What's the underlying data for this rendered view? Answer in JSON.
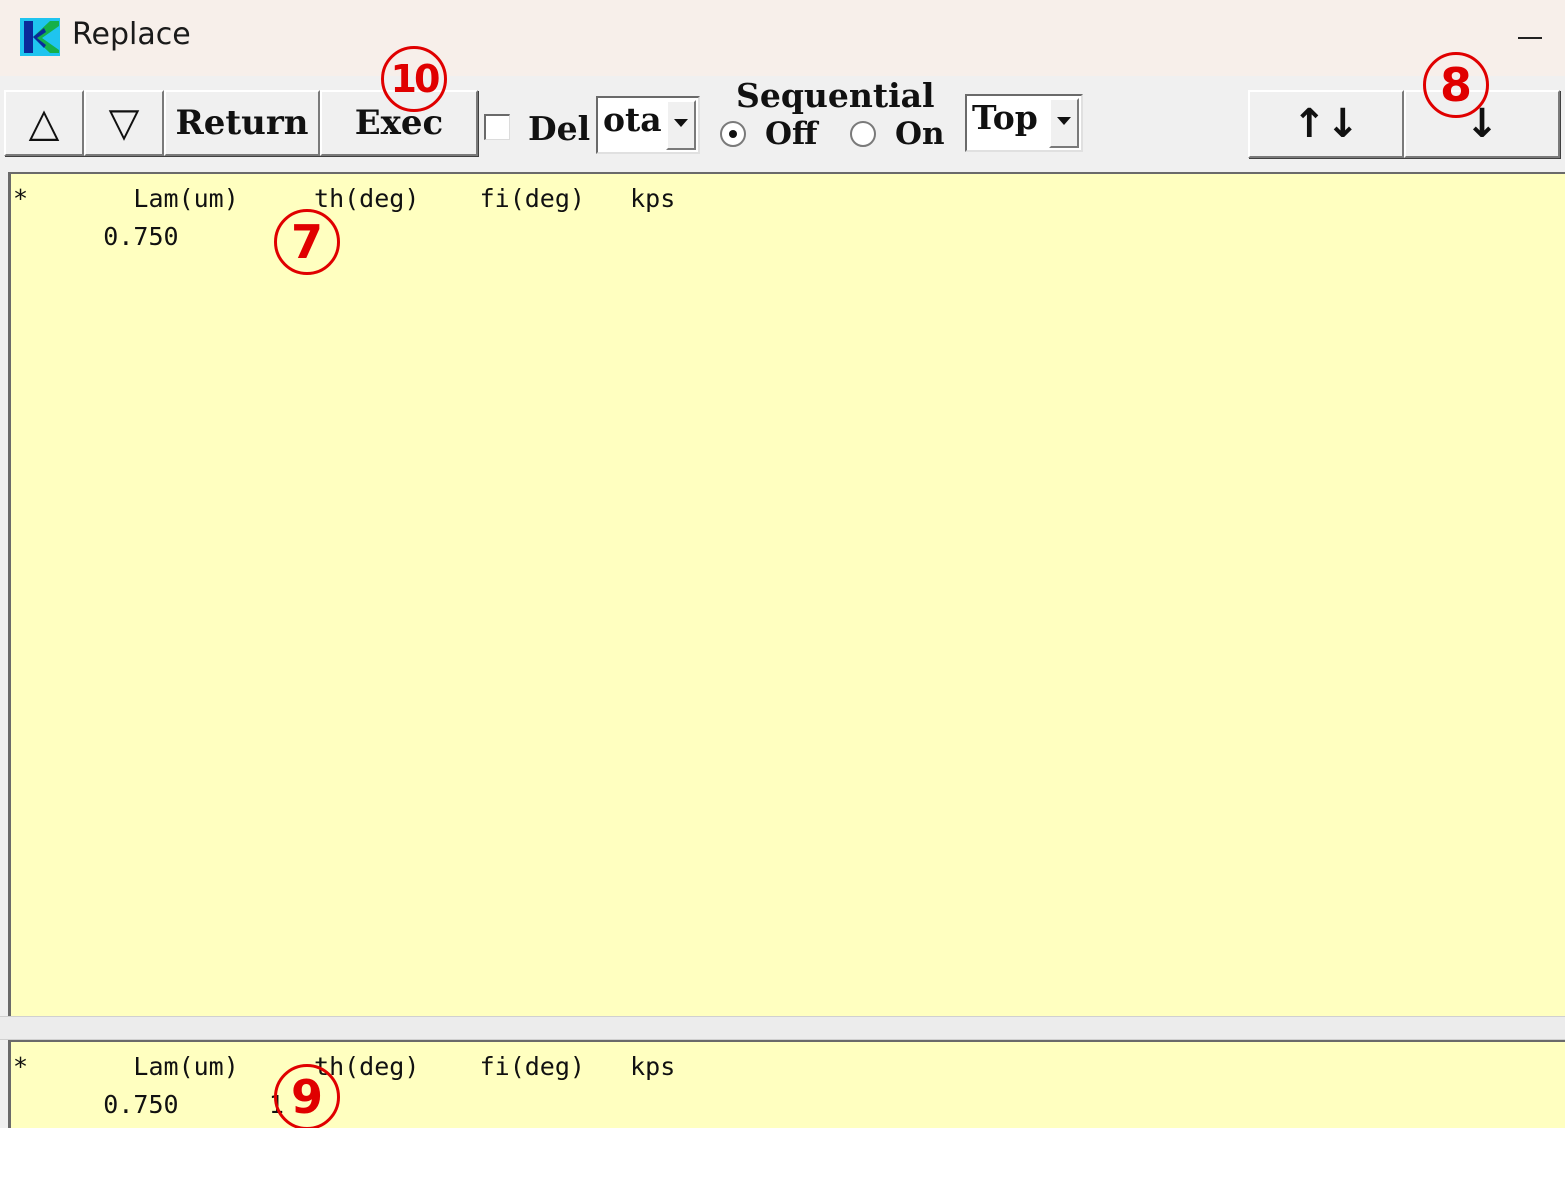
{
  "window": {
    "title": "Replace"
  },
  "toolbar": {
    "up_button": "△",
    "down_button": "▽",
    "return_label": "Return",
    "exec_label": "Exec",
    "del_label": "Del",
    "del_checked": false,
    "field_select": "ota",
    "sequential_label": "Sequential",
    "sequential_options": [
      "Off",
      "On"
    ],
    "sequential_selected": "Off",
    "position_select": "Top",
    "swap_button": "↑↓",
    "down_arrow_button": "↓"
  },
  "upper_panel": {
    "header": "*       Lam(um)     th(deg)    fi(deg)   kps",
    "row": "      0.750"
  },
  "lower_panel": {
    "header": "*       Lam(um)     th(deg)    fi(deg)   kps",
    "row": "      0.750      1"
  },
  "markers": {
    "m7": "7",
    "m8": "8",
    "m9": "9",
    "m10": "10"
  },
  "colors": {
    "panel_bg": "#ffffc0",
    "marker": "#e00000",
    "titlebar_bg": "#f7efea"
  }
}
